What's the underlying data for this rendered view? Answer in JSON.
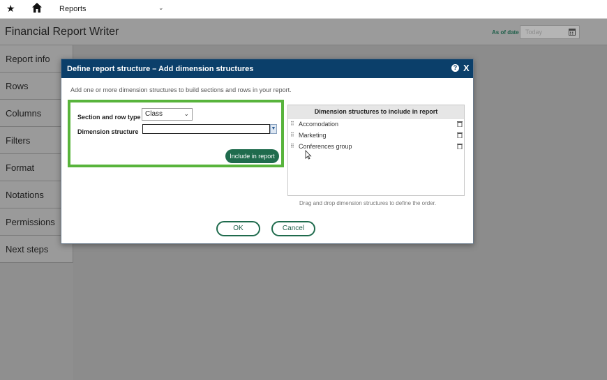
{
  "topbar": {
    "breadcrumb": "Reports"
  },
  "header": {
    "title": "Financial Report Writer",
    "as_of_label": "As of date",
    "date_placeholder": "Today"
  },
  "sidebar": {
    "items": [
      {
        "label": "Report info"
      },
      {
        "label": "Rows"
      },
      {
        "label": "Columns"
      },
      {
        "label": "Filters"
      },
      {
        "label": "Format"
      },
      {
        "label": "Notations"
      },
      {
        "label": "Permissions"
      },
      {
        "label": "Next steps"
      }
    ]
  },
  "dialog": {
    "title": "Define report structure – Add dimension structures",
    "description": "Add one or more dimension structures to build sections and rows in your report.",
    "section_row_type_label": "Section and row type",
    "section_row_type_value": "Class",
    "dimension_structure_label": "Dimension structure",
    "dimension_structure_value": "",
    "include_button": "Include in report",
    "panel_title": "Dimension structures to include in report",
    "structures": [
      "Accomodation",
      "Marketing",
      "Conferences group"
    ],
    "panel_note": "Drag and drop dimension structures to define the order.",
    "ok_button": "OK",
    "cancel_button": "Cancel"
  },
  "colors": {
    "dialog_header": "#0b3f6a",
    "accent_green": "#1f6b4d",
    "highlight": "#58b43c"
  }
}
